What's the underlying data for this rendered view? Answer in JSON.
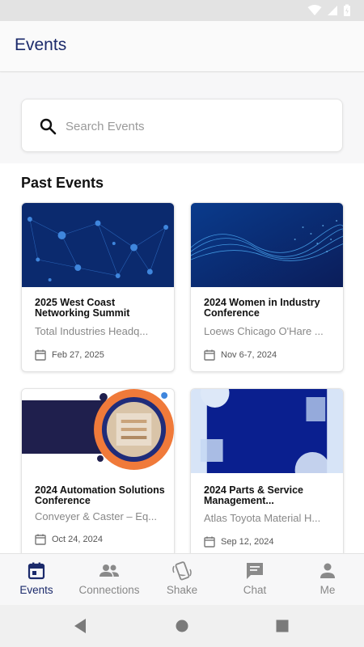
{
  "header": {
    "title": "Events"
  },
  "search": {
    "placeholder": "Search Events"
  },
  "section": {
    "title": "Past Events"
  },
  "events": [
    {
      "title": "2025 West Coast Networking Summit",
      "location": "Total Industries Headq...",
      "date": "Feb 27, 2025"
    },
    {
      "title": "2024 Women in Industry Conference",
      "location": "Loews Chicago O'Hare ...",
      "date": "Nov 6-7, 2024"
    },
    {
      "title": "2024 Automation Solutions Conference",
      "location": "Conveyer & Caster – Eq...",
      "date": "Oct 24, 2024"
    },
    {
      "title": "2024 Parts & Service Management...",
      "location": "Atlas Toyota Material H...",
      "date": "Sep 12, 2024"
    }
  ],
  "nav": {
    "items": [
      {
        "label": "Events",
        "icon": "calendar-icon",
        "active": true
      },
      {
        "label": "Connections",
        "icon": "people-icon"
      },
      {
        "label": "Shake",
        "icon": "shake-icon"
      },
      {
        "label": "Chat",
        "icon": "chat-icon"
      },
      {
        "label": "Me",
        "icon": "person-icon"
      }
    ]
  },
  "colors": {
    "accent": "#1b2a6b",
    "muted": "#888888",
    "card_navy": "#0b2a6e",
    "card_blue": "#0a1f8f",
    "orange": "#f07a3a"
  }
}
